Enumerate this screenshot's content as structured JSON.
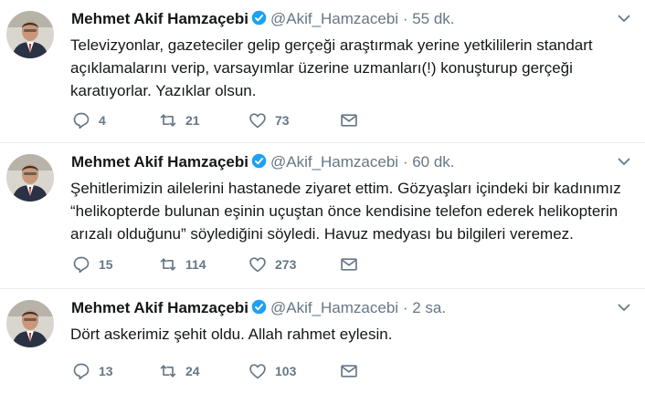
{
  "tweets": [
    {
      "name": "Mehmet Akif Hamzaçebi",
      "handle": "@Akif_Hamzacebi",
      "separator": "·",
      "time": "55 dk.",
      "text": "Televizyonlar, gazeteciler gelip gerçeği araştırmak yerine yetkililerin standart\naçıklamalarını verip, varsayımlar üzerine uzmanları(!) konuşturup gerçeği\nkaratıyorlar. Yazıklar olsun.",
      "replies": "4",
      "retweets": "21",
      "likes": "73"
    },
    {
      "name": "Mehmet Akif Hamzaçebi",
      "handle": "@Akif_Hamzacebi",
      "separator": "·",
      "time": "60 dk.",
      "text": "Şehitlerimizin ailelerini hastanede ziyaret ettim. Gözyaşları içindeki bir kadınımız\n“helikopterde bulunan eşinin uçuştan önce kendisine telefon ederek helikopterin\narızalı olduğunu” söylediğini söyledi. Havuz medyası bu bilgileri veremez.",
      "replies": "15",
      "retweets": "114",
      "likes": "273"
    },
    {
      "name": "Mehmet Akif Hamzaçebi",
      "handle": "@Akif_Hamzacebi",
      "separator": "·",
      "time": "2 sa.",
      "text": "Dört askerimiz şehit oldu. Allah rahmet eylesin.",
      "replies": "13",
      "retweets": "24",
      "likes": "103"
    }
  ],
  "icons": {
    "verified": "verified-badge-icon",
    "caret": "chevron-down-icon",
    "reply": "reply-icon",
    "retweet": "retweet-icon",
    "like": "heart-icon",
    "message": "envelope-icon"
  },
  "colors": {
    "name": "#14171a",
    "secondary": "#657786",
    "verified": "#1da1f2",
    "border": "#e6ecf0"
  }
}
